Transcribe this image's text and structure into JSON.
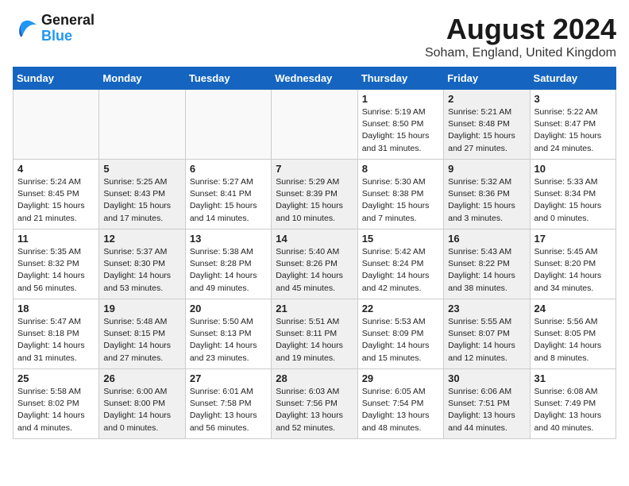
{
  "header": {
    "logo_line1": "General",
    "logo_line2": "Blue",
    "month_year": "August 2024",
    "location": "Soham, England, United Kingdom"
  },
  "weekdays": [
    "Sunday",
    "Monday",
    "Tuesday",
    "Wednesday",
    "Thursday",
    "Friday",
    "Saturday"
  ],
  "weeks": [
    [
      {
        "day": "",
        "info": "",
        "shaded": false,
        "empty": true
      },
      {
        "day": "",
        "info": "",
        "shaded": false,
        "empty": true
      },
      {
        "day": "",
        "info": "",
        "shaded": false,
        "empty": true
      },
      {
        "day": "",
        "info": "",
        "shaded": false,
        "empty": true
      },
      {
        "day": "1",
        "info": "Sunrise: 5:19 AM\nSunset: 8:50 PM\nDaylight: 15 hours\nand 31 minutes.",
        "shaded": false,
        "empty": false
      },
      {
        "day": "2",
        "info": "Sunrise: 5:21 AM\nSunset: 8:48 PM\nDaylight: 15 hours\nand 27 minutes.",
        "shaded": true,
        "empty": false
      },
      {
        "day": "3",
        "info": "Sunrise: 5:22 AM\nSunset: 8:47 PM\nDaylight: 15 hours\nand 24 minutes.",
        "shaded": false,
        "empty": false
      }
    ],
    [
      {
        "day": "4",
        "info": "Sunrise: 5:24 AM\nSunset: 8:45 PM\nDaylight: 15 hours\nand 21 minutes.",
        "shaded": false,
        "empty": false
      },
      {
        "day": "5",
        "info": "Sunrise: 5:25 AM\nSunset: 8:43 PM\nDaylight: 15 hours\nand 17 minutes.",
        "shaded": true,
        "empty": false
      },
      {
        "day": "6",
        "info": "Sunrise: 5:27 AM\nSunset: 8:41 PM\nDaylight: 15 hours\nand 14 minutes.",
        "shaded": false,
        "empty": false
      },
      {
        "day": "7",
        "info": "Sunrise: 5:29 AM\nSunset: 8:39 PM\nDaylight: 15 hours\nand 10 minutes.",
        "shaded": true,
        "empty": false
      },
      {
        "day": "8",
        "info": "Sunrise: 5:30 AM\nSunset: 8:38 PM\nDaylight: 15 hours\nand 7 minutes.",
        "shaded": false,
        "empty": false
      },
      {
        "day": "9",
        "info": "Sunrise: 5:32 AM\nSunset: 8:36 PM\nDaylight: 15 hours\nand 3 minutes.",
        "shaded": true,
        "empty": false
      },
      {
        "day": "10",
        "info": "Sunrise: 5:33 AM\nSunset: 8:34 PM\nDaylight: 15 hours\nand 0 minutes.",
        "shaded": false,
        "empty": false
      }
    ],
    [
      {
        "day": "11",
        "info": "Sunrise: 5:35 AM\nSunset: 8:32 PM\nDaylight: 14 hours\nand 56 minutes.",
        "shaded": false,
        "empty": false
      },
      {
        "day": "12",
        "info": "Sunrise: 5:37 AM\nSunset: 8:30 PM\nDaylight: 14 hours\nand 53 minutes.",
        "shaded": true,
        "empty": false
      },
      {
        "day": "13",
        "info": "Sunrise: 5:38 AM\nSunset: 8:28 PM\nDaylight: 14 hours\nand 49 minutes.",
        "shaded": false,
        "empty": false
      },
      {
        "day": "14",
        "info": "Sunrise: 5:40 AM\nSunset: 8:26 PM\nDaylight: 14 hours\nand 45 minutes.",
        "shaded": true,
        "empty": false
      },
      {
        "day": "15",
        "info": "Sunrise: 5:42 AM\nSunset: 8:24 PM\nDaylight: 14 hours\nand 42 minutes.",
        "shaded": false,
        "empty": false
      },
      {
        "day": "16",
        "info": "Sunrise: 5:43 AM\nSunset: 8:22 PM\nDaylight: 14 hours\nand 38 minutes.",
        "shaded": true,
        "empty": false
      },
      {
        "day": "17",
        "info": "Sunrise: 5:45 AM\nSunset: 8:20 PM\nDaylight: 14 hours\nand 34 minutes.",
        "shaded": false,
        "empty": false
      }
    ],
    [
      {
        "day": "18",
        "info": "Sunrise: 5:47 AM\nSunset: 8:18 PM\nDaylight: 14 hours\nand 31 minutes.",
        "shaded": false,
        "empty": false
      },
      {
        "day": "19",
        "info": "Sunrise: 5:48 AM\nSunset: 8:15 PM\nDaylight: 14 hours\nand 27 minutes.",
        "shaded": true,
        "empty": false
      },
      {
        "day": "20",
        "info": "Sunrise: 5:50 AM\nSunset: 8:13 PM\nDaylight: 14 hours\nand 23 minutes.",
        "shaded": false,
        "empty": false
      },
      {
        "day": "21",
        "info": "Sunrise: 5:51 AM\nSunset: 8:11 PM\nDaylight: 14 hours\nand 19 minutes.",
        "shaded": true,
        "empty": false
      },
      {
        "day": "22",
        "info": "Sunrise: 5:53 AM\nSunset: 8:09 PM\nDaylight: 14 hours\nand 15 minutes.",
        "shaded": false,
        "empty": false
      },
      {
        "day": "23",
        "info": "Sunrise: 5:55 AM\nSunset: 8:07 PM\nDaylight: 14 hours\nand 12 minutes.",
        "shaded": true,
        "empty": false
      },
      {
        "day": "24",
        "info": "Sunrise: 5:56 AM\nSunset: 8:05 PM\nDaylight: 14 hours\nand 8 minutes.",
        "shaded": false,
        "empty": false
      }
    ],
    [
      {
        "day": "25",
        "info": "Sunrise: 5:58 AM\nSunset: 8:02 PM\nDaylight: 14 hours\nand 4 minutes.",
        "shaded": false,
        "empty": false
      },
      {
        "day": "26",
        "info": "Sunrise: 6:00 AM\nSunset: 8:00 PM\nDaylight: 14 hours\nand 0 minutes.",
        "shaded": true,
        "empty": false
      },
      {
        "day": "27",
        "info": "Sunrise: 6:01 AM\nSunset: 7:58 PM\nDaylight: 13 hours\nand 56 minutes.",
        "shaded": false,
        "empty": false
      },
      {
        "day": "28",
        "info": "Sunrise: 6:03 AM\nSunset: 7:56 PM\nDaylight: 13 hours\nand 52 minutes.",
        "shaded": true,
        "empty": false
      },
      {
        "day": "29",
        "info": "Sunrise: 6:05 AM\nSunset: 7:54 PM\nDaylight: 13 hours\nand 48 minutes.",
        "shaded": false,
        "empty": false
      },
      {
        "day": "30",
        "info": "Sunrise: 6:06 AM\nSunset: 7:51 PM\nDaylight: 13 hours\nand 44 minutes.",
        "shaded": true,
        "empty": false
      },
      {
        "day": "31",
        "info": "Sunrise: 6:08 AM\nSunset: 7:49 PM\nDaylight: 13 hours\nand 40 minutes.",
        "shaded": false,
        "empty": false
      }
    ]
  ]
}
